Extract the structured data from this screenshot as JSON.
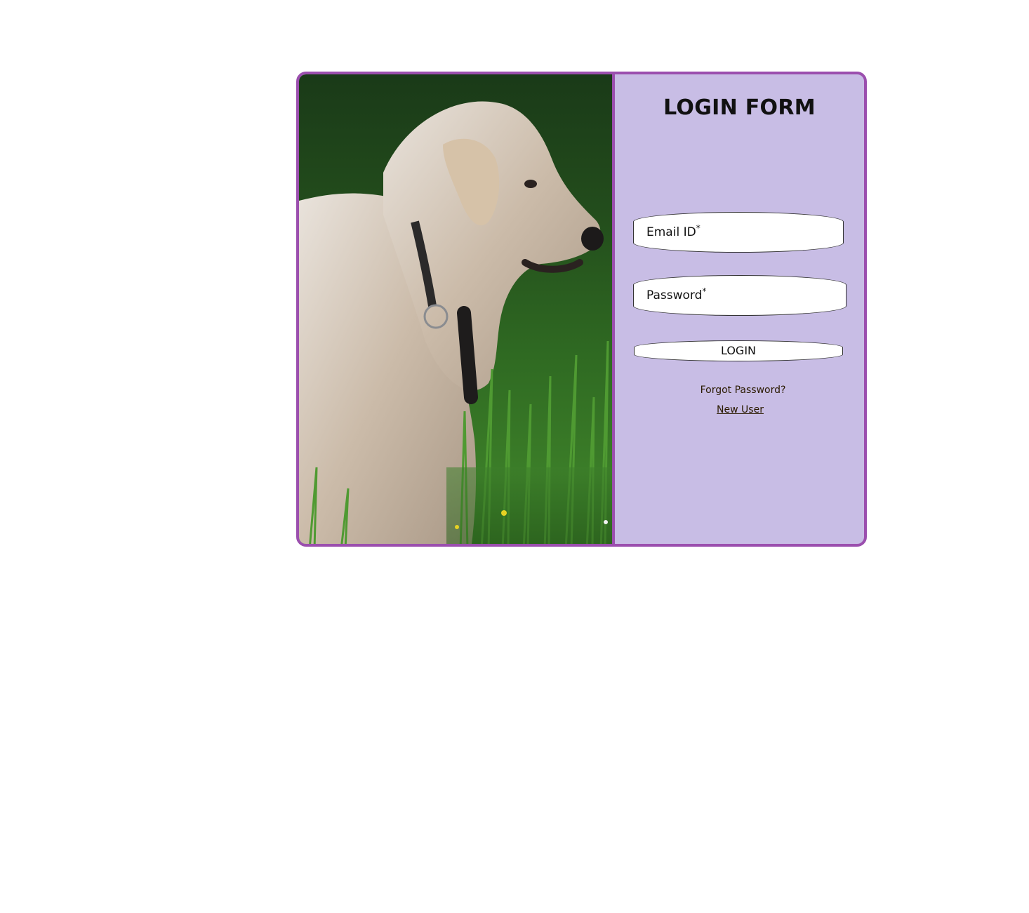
{
  "form": {
    "title": "LOGIN FORM",
    "email_label": "Email ID",
    "password_label": "Password",
    "required_mark": "*",
    "login_label": "LOGIN",
    "forgot_label": "Forgot Password?",
    "new_user_label": "New User"
  },
  "photo": {
    "subject": "white long-haired dog in green grass"
  },
  "colors": {
    "border": "#9b4fae",
    "panel": "#c8bde5",
    "link": "#2a1a00"
  }
}
